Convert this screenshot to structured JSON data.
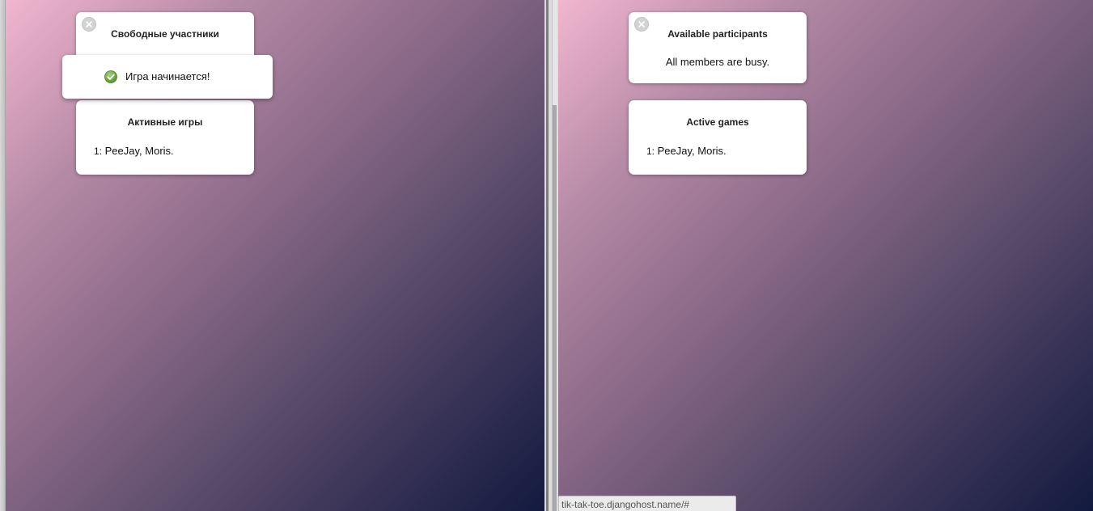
{
  "left_window": {
    "participants_card": {
      "title": "Свободные участники"
    },
    "toast": {
      "message": "Игра начинается!",
      "icon": "check-circle-icon"
    },
    "games_card": {
      "title": "Активные игры",
      "games": [
        {
          "number": "1:",
          "players": "PeeJay, Moris."
        }
      ]
    }
  },
  "right_window": {
    "participants_card": {
      "title": "Available participants",
      "message": "All members are busy."
    },
    "games_card": {
      "title": "Active games",
      "games": [
        {
          "number": "1:",
          "players": "PeeJay, Moris."
        }
      ]
    }
  },
  "statusbar": {
    "url": "tik-tak-toe.djangohost.name/#"
  },
  "colors": {
    "gradient_start": "#f2b6cf",
    "gradient_end": "#121a3f",
    "success": "#6aaa3a"
  }
}
